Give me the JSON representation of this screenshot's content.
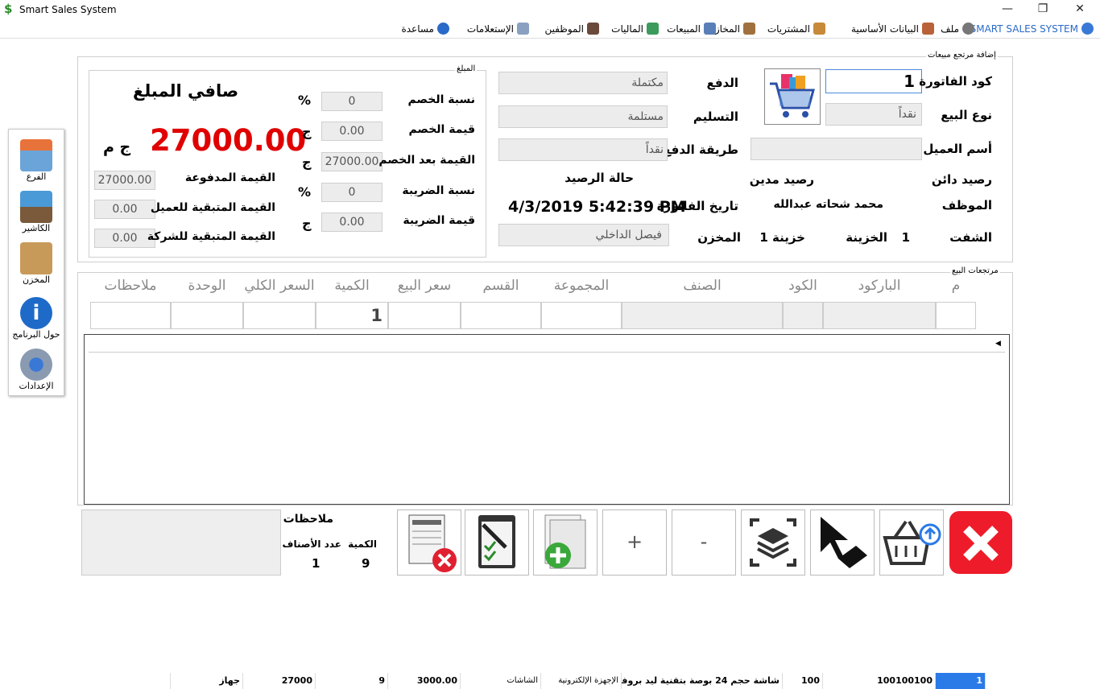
{
  "window": {
    "title": "Smart Sales System",
    "min": "—",
    "restore": "❐",
    "close": "✕"
  },
  "menu": {
    "brand": "SMART SALES SYSTEM",
    "items": [
      "ملف",
      "البيانات الأساسية",
      "المشتريات",
      "المخازن",
      "المبيعات",
      "الماليات",
      "الموظفين",
      "الإستعلامات",
      "مساعدة"
    ]
  },
  "sidebar": [
    "الفرع",
    "الكاشير",
    "المخزن",
    "حول البرنامج",
    "الإعدادات"
  ],
  "header_group": {
    "label": "إضافة مرتجع مبيعات",
    "invoice_code_label": "كود الفاتورة",
    "invoice_code": "1",
    "sale_type_label": "نوع البيع",
    "sale_type": "نقداً",
    "customer_label": "أسم العميل",
    "customer": "",
    "credit_label": "رصيد دائن",
    "debit_label": "رصيد مدين",
    "balance_status_label": "حالة الرصيد",
    "payment_label": "الدفع",
    "payment": "مكتملة",
    "delivery_label": "التسليم",
    "delivery": "مستلمة",
    "pay_method_label": "طريقة الدفع",
    "pay_method": "نقداً",
    "employee_label": "الموظف",
    "employee": "محمد شحاته عبدالله",
    "invoice_date_label": "تاريخ الفاتورة",
    "invoice_date": "4/3/2019 5:42:39 PM",
    "shift_label": "الشفت",
    "shift": "1",
    "treasury_label": "الخزينة",
    "treasury": "خزينة 1",
    "store_label": "المخزن",
    "store": "فيصل الداخلي"
  },
  "amount_group": {
    "label": "المبلغ",
    "discount_pct_label": "نسبة الخصم",
    "discount_pct": "0",
    "discount_val_label": "قيمة الخصم",
    "discount_val": "0.00",
    "after_discount_label": "القيمة بعد الخصم",
    "after_discount": "27000.00",
    "tax_pct_label": "نسبة الضريبة",
    "tax_pct": "0",
    "tax_val_label": "قيمة الضريبة",
    "tax_val": "0.00",
    "pct_sign": "%",
    "currency": "ج",
    "net_label": "صافي المبلغ",
    "net_value": "27000.00",
    "net_currency": "ج م",
    "paid_label": "القيمة المدفوعة",
    "paid": "27000.00",
    "remain_customer_label": "القيمة المتبقية للعميل",
    "remain_customer": "0.00",
    "remain_company_label": "القيمة المتبقية للشركة",
    "remain_company": "0.00"
  },
  "returns": {
    "label": "مرتجعات البيع",
    "columns": [
      "م",
      "الباركود",
      "الكود",
      "الصنف",
      "المجموعة",
      "القسم",
      "سعر البيع",
      "الكمية",
      "السعر الكلي",
      "الوحدة",
      "ملاحظات"
    ],
    "entry_qty": "1",
    "row": {
      "index": "1",
      "barcode": "100100100",
      "code": "100",
      "item": "شاشة حجم 24 بوصة بتقنية ليد بروفي...",
      "group": "الإجهزة الإلكترونية",
      "section": "الشاشات",
      "price": "3000.00",
      "qty": "9",
      "total": "27000",
      "unit": "جهاز",
      "notes": ""
    }
  },
  "footer": {
    "notes_label": "ملاحظات",
    "items_count_label": "عدد الأصناف",
    "items_count": "1",
    "qty_label": "الكمية",
    "qty": "9",
    "plus": "+",
    "minus": "-"
  }
}
